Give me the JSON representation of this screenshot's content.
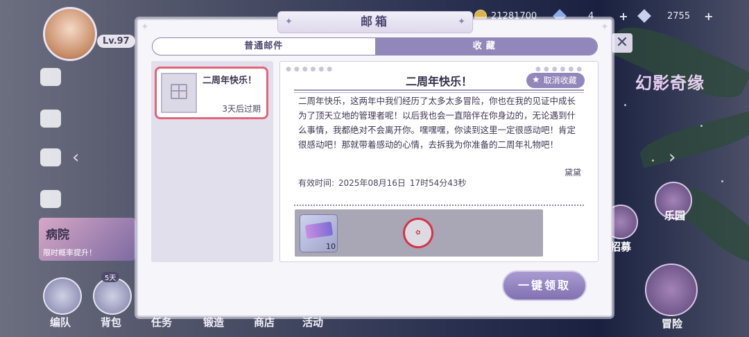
{
  "hud": {
    "level": "Lv.97",
    "gold": "21281700",
    "gems_blue": "4",
    "gems_white": "2755",
    "plus": "+"
  },
  "background": {
    "logo_text": "幻影奇缘",
    "banner_title": "病院",
    "banner_sub": "限时概率提升！",
    "timer": "5天",
    "bottom_nav": [
      "编队",
      "背包",
      "任务",
      "锻造",
      "商店",
      "活动"
    ],
    "right_nav": [
      "招募",
      "乐园",
      "冒险"
    ]
  },
  "dialog": {
    "title": "邮箱",
    "tabs": [
      {
        "label": "普通邮件",
        "active": false
      },
      {
        "label": "收藏",
        "active": true
      }
    ],
    "mail_list": [
      {
        "title": "二周年快乐！",
        "expire": "3天后过期",
        "selected": true
      }
    ],
    "mail": {
      "title": "二周年快乐！",
      "unfavorite_label": "取消收藏",
      "body": "二周年快乐，这两年中我们经历了太多太多冒险，你也在我的见证中成长为了顶天立地的管理者呢！以后我也会一直陪伴在你身边的，无论遇到什么事情，我都绝对不会离开你。嘿嘿嘿，你读到这里一定很感动吧！肯定很感动吧！那就带着感动的心情，去拆我为你准备的二周年礼物吧！",
      "signature": "黛黛",
      "expire_text": "有效时间: 2025年08月16日   17时54分43秒",
      "attachments": [
        {
          "icon": "ticket-icon",
          "qty": "10"
        }
      ],
      "stamp_icon": "claimed-stamp-icon"
    },
    "claim_all_label": "一键领取"
  },
  "close_icon": "✕"
}
